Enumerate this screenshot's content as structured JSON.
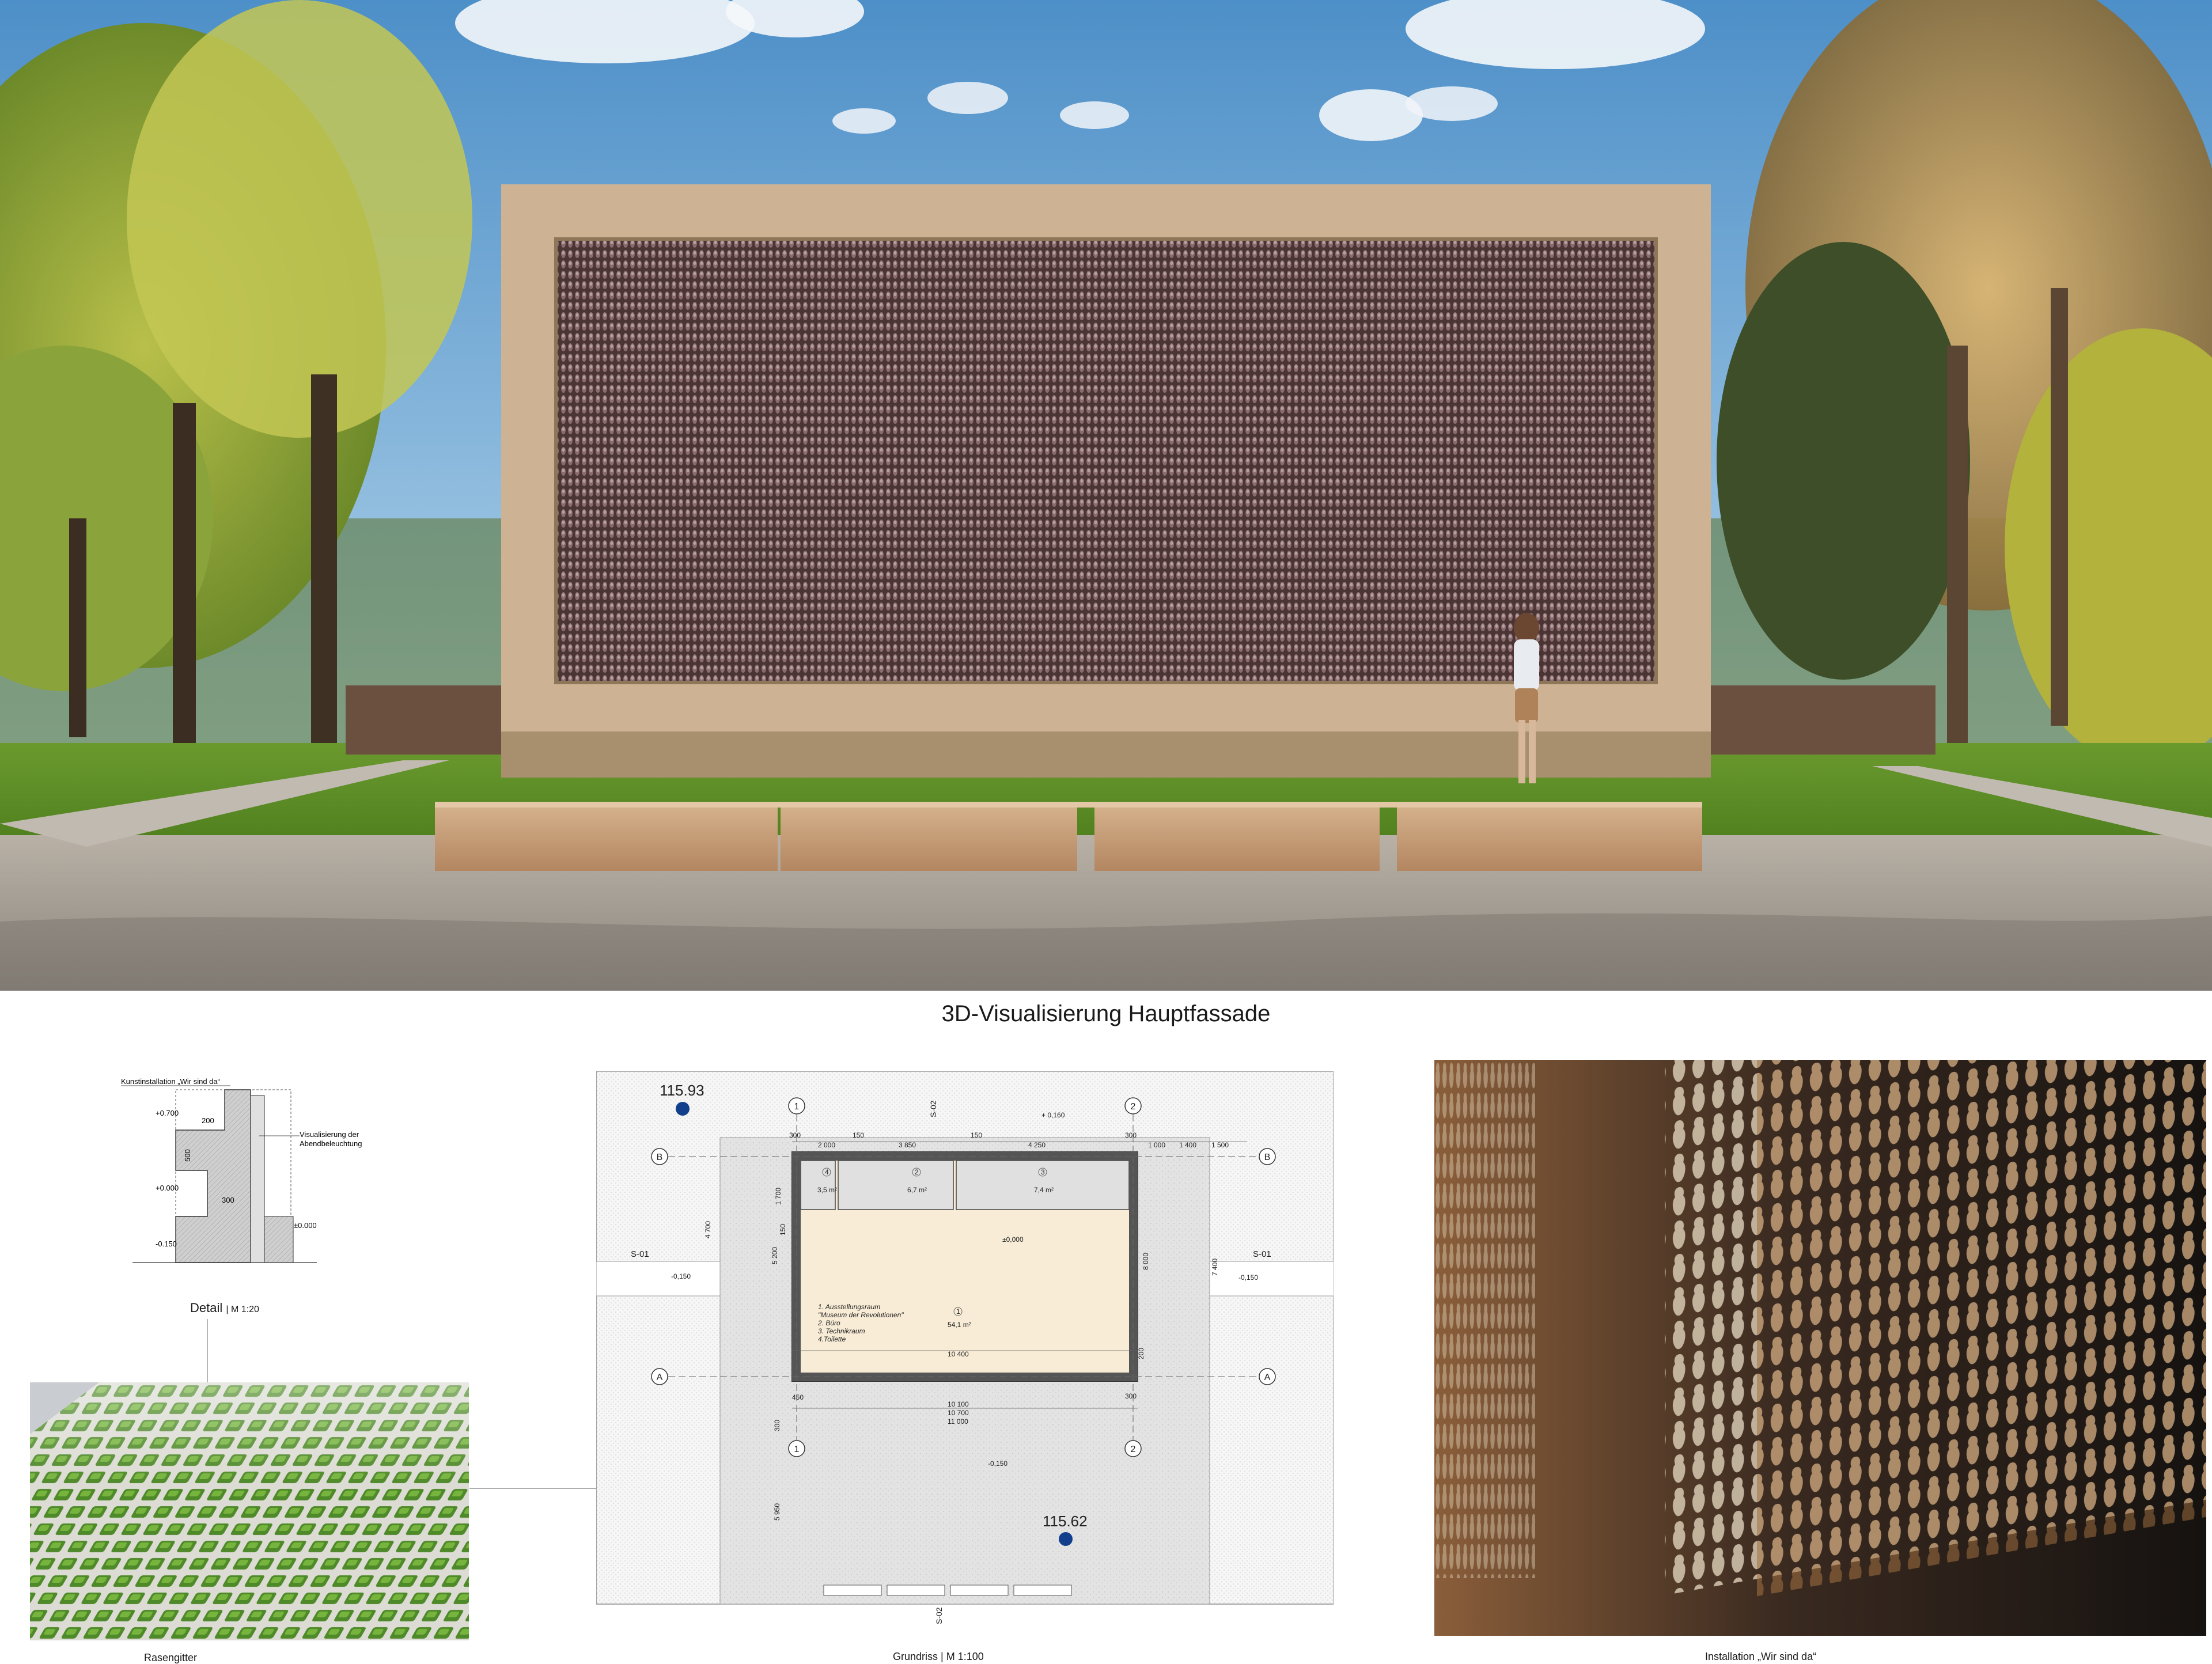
{
  "hero": {
    "caption": "3D-Visualisierung Hauptfassade"
  },
  "detail": {
    "title": "Kunstinstallation „Wir sind da“",
    "annotation_line1": "Visualisierung der",
    "annotation_line2": "Abendbeleuchtung",
    "caption_label": "Detail",
    "caption_scale": "| M 1:20",
    "dim_200": "200",
    "dim_300": "300",
    "dim_500": "500",
    "level_top": "+0.700",
    "level_mid": "+0.000",
    "level_bottom": "-0.150",
    "level_right": "±0.000"
  },
  "plan": {
    "level_nw": "115.93",
    "level_se": "115.62",
    "grid_1": "1",
    "grid_2": "2",
    "grid_A": "A",
    "grid_B": "B",
    "section_s01": "S-01",
    "section_s02": "S-02",
    "ne_level": "+ 0,160",
    "main_level": "±0,000",
    "level_neg150": "-0,150",
    "room_1_area": "54,1 m²",
    "room_2_area": "6,7 m²",
    "room_3_area": "7,4 m²",
    "room_4_area": "3,5 m²",
    "legend_1": "1. Ausstellungsraum",
    "legend_1b": "\"Museum der Revolutionen\"",
    "legend_2": "2. Büro",
    "legend_3": "3. Technikraum",
    "legend_4": "4.Toilette",
    "dims_top": [
      "300",
      "2 000",
      "150",
      "3 850",
      "150",
      "4 250",
      "300",
      "1 000",
      "1 400",
      "1 500"
    ],
    "dim_10400": "10 400",
    "dim_10100": "10 100",
    "dim_10700": "10 700",
    "dim_11000": "11 000",
    "dim_8000": "8 000",
    "dim_7400": "7 400",
    "dim_5200": "5 200",
    "dim_1700": "1 700",
    "dim_4700": "4 700",
    "dim_150": "150",
    "dim_300": "300",
    "dim_450": "450",
    "dim_200": "200",
    "dim_5950": "5 950",
    "room_num_1": "1",
    "room_num_2": "2",
    "room_num_3": "3",
    "room_num_4": "4"
  },
  "paver": {
    "caption": "Rasengitter"
  },
  "plan_caption": "Grundriss | M 1:100",
  "wall_caption": "Installation „Wir sind da“"
}
